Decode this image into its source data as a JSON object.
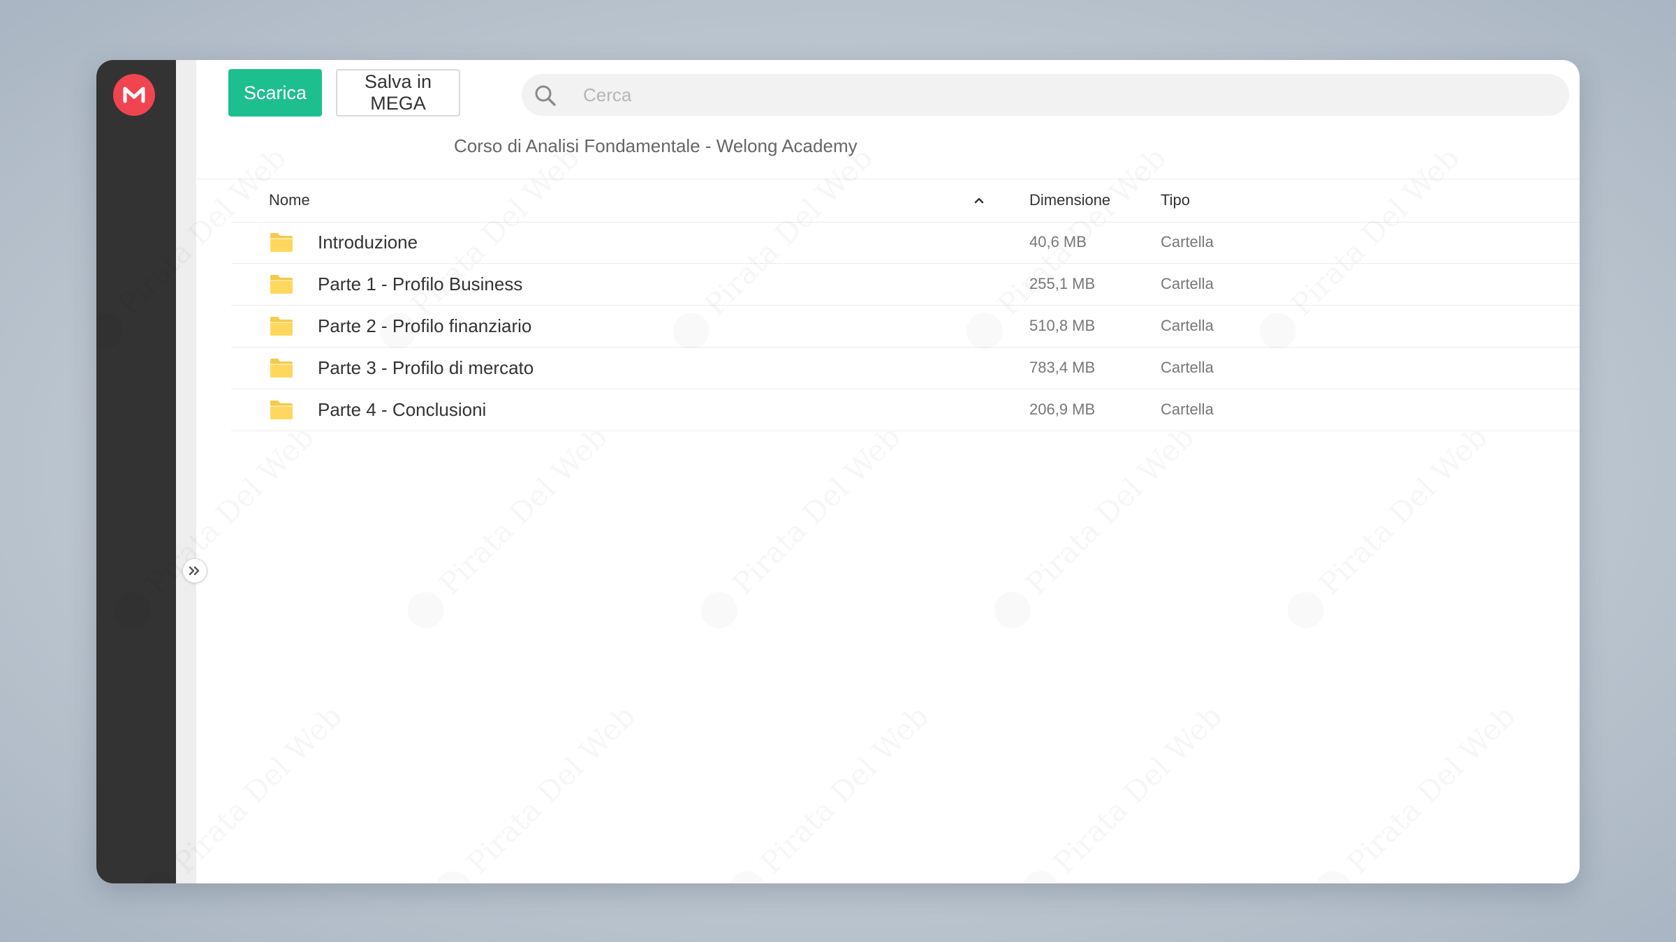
{
  "colors": {
    "accent": "#1ebf8e",
    "brand": "#f04451",
    "sidebar": "#333333",
    "folder": "#ffd75e"
  },
  "app": {
    "logo_icon": "mega-logo-icon",
    "expand_icon": "double-chevron-right-icon"
  },
  "toolbar": {
    "download_label": "Scarica",
    "save_label": "Salva in MEGA"
  },
  "search": {
    "icon": "search-icon",
    "placeholder": "Cerca",
    "value": ""
  },
  "breadcrumb": {
    "text": "Corso di Analisi Fondamentale - Welong Academy"
  },
  "table": {
    "columns": {
      "name": "Nome",
      "size": "Dimensione",
      "type": "Tipo"
    },
    "sort_icon": "chevron-up-icon",
    "rows": [
      {
        "icon": "folder-icon",
        "name": "Introduzione",
        "size": "40,6 MB",
        "type": "Cartella"
      },
      {
        "icon": "folder-icon",
        "name": "Parte 1 - Profilo Business",
        "size": "255,1 MB",
        "type": "Cartella"
      },
      {
        "icon": "folder-icon",
        "name": "Parte 2 - Profilo finanziario",
        "size": "510,8 MB",
        "type": "Cartella"
      },
      {
        "icon": "folder-icon",
        "name": "Parte 3 - Profilo di mercato",
        "size": "783,4 MB",
        "type": "Cartella"
      },
      {
        "icon": "folder-icon",
        "name": "Parte 4 - Conclusioni",
        "size": "206,9 MB",
        "type": "Cartella"
      }
    ]
  },
  "watermark": {
    "text": "Pirata Del Web"
  }
}
